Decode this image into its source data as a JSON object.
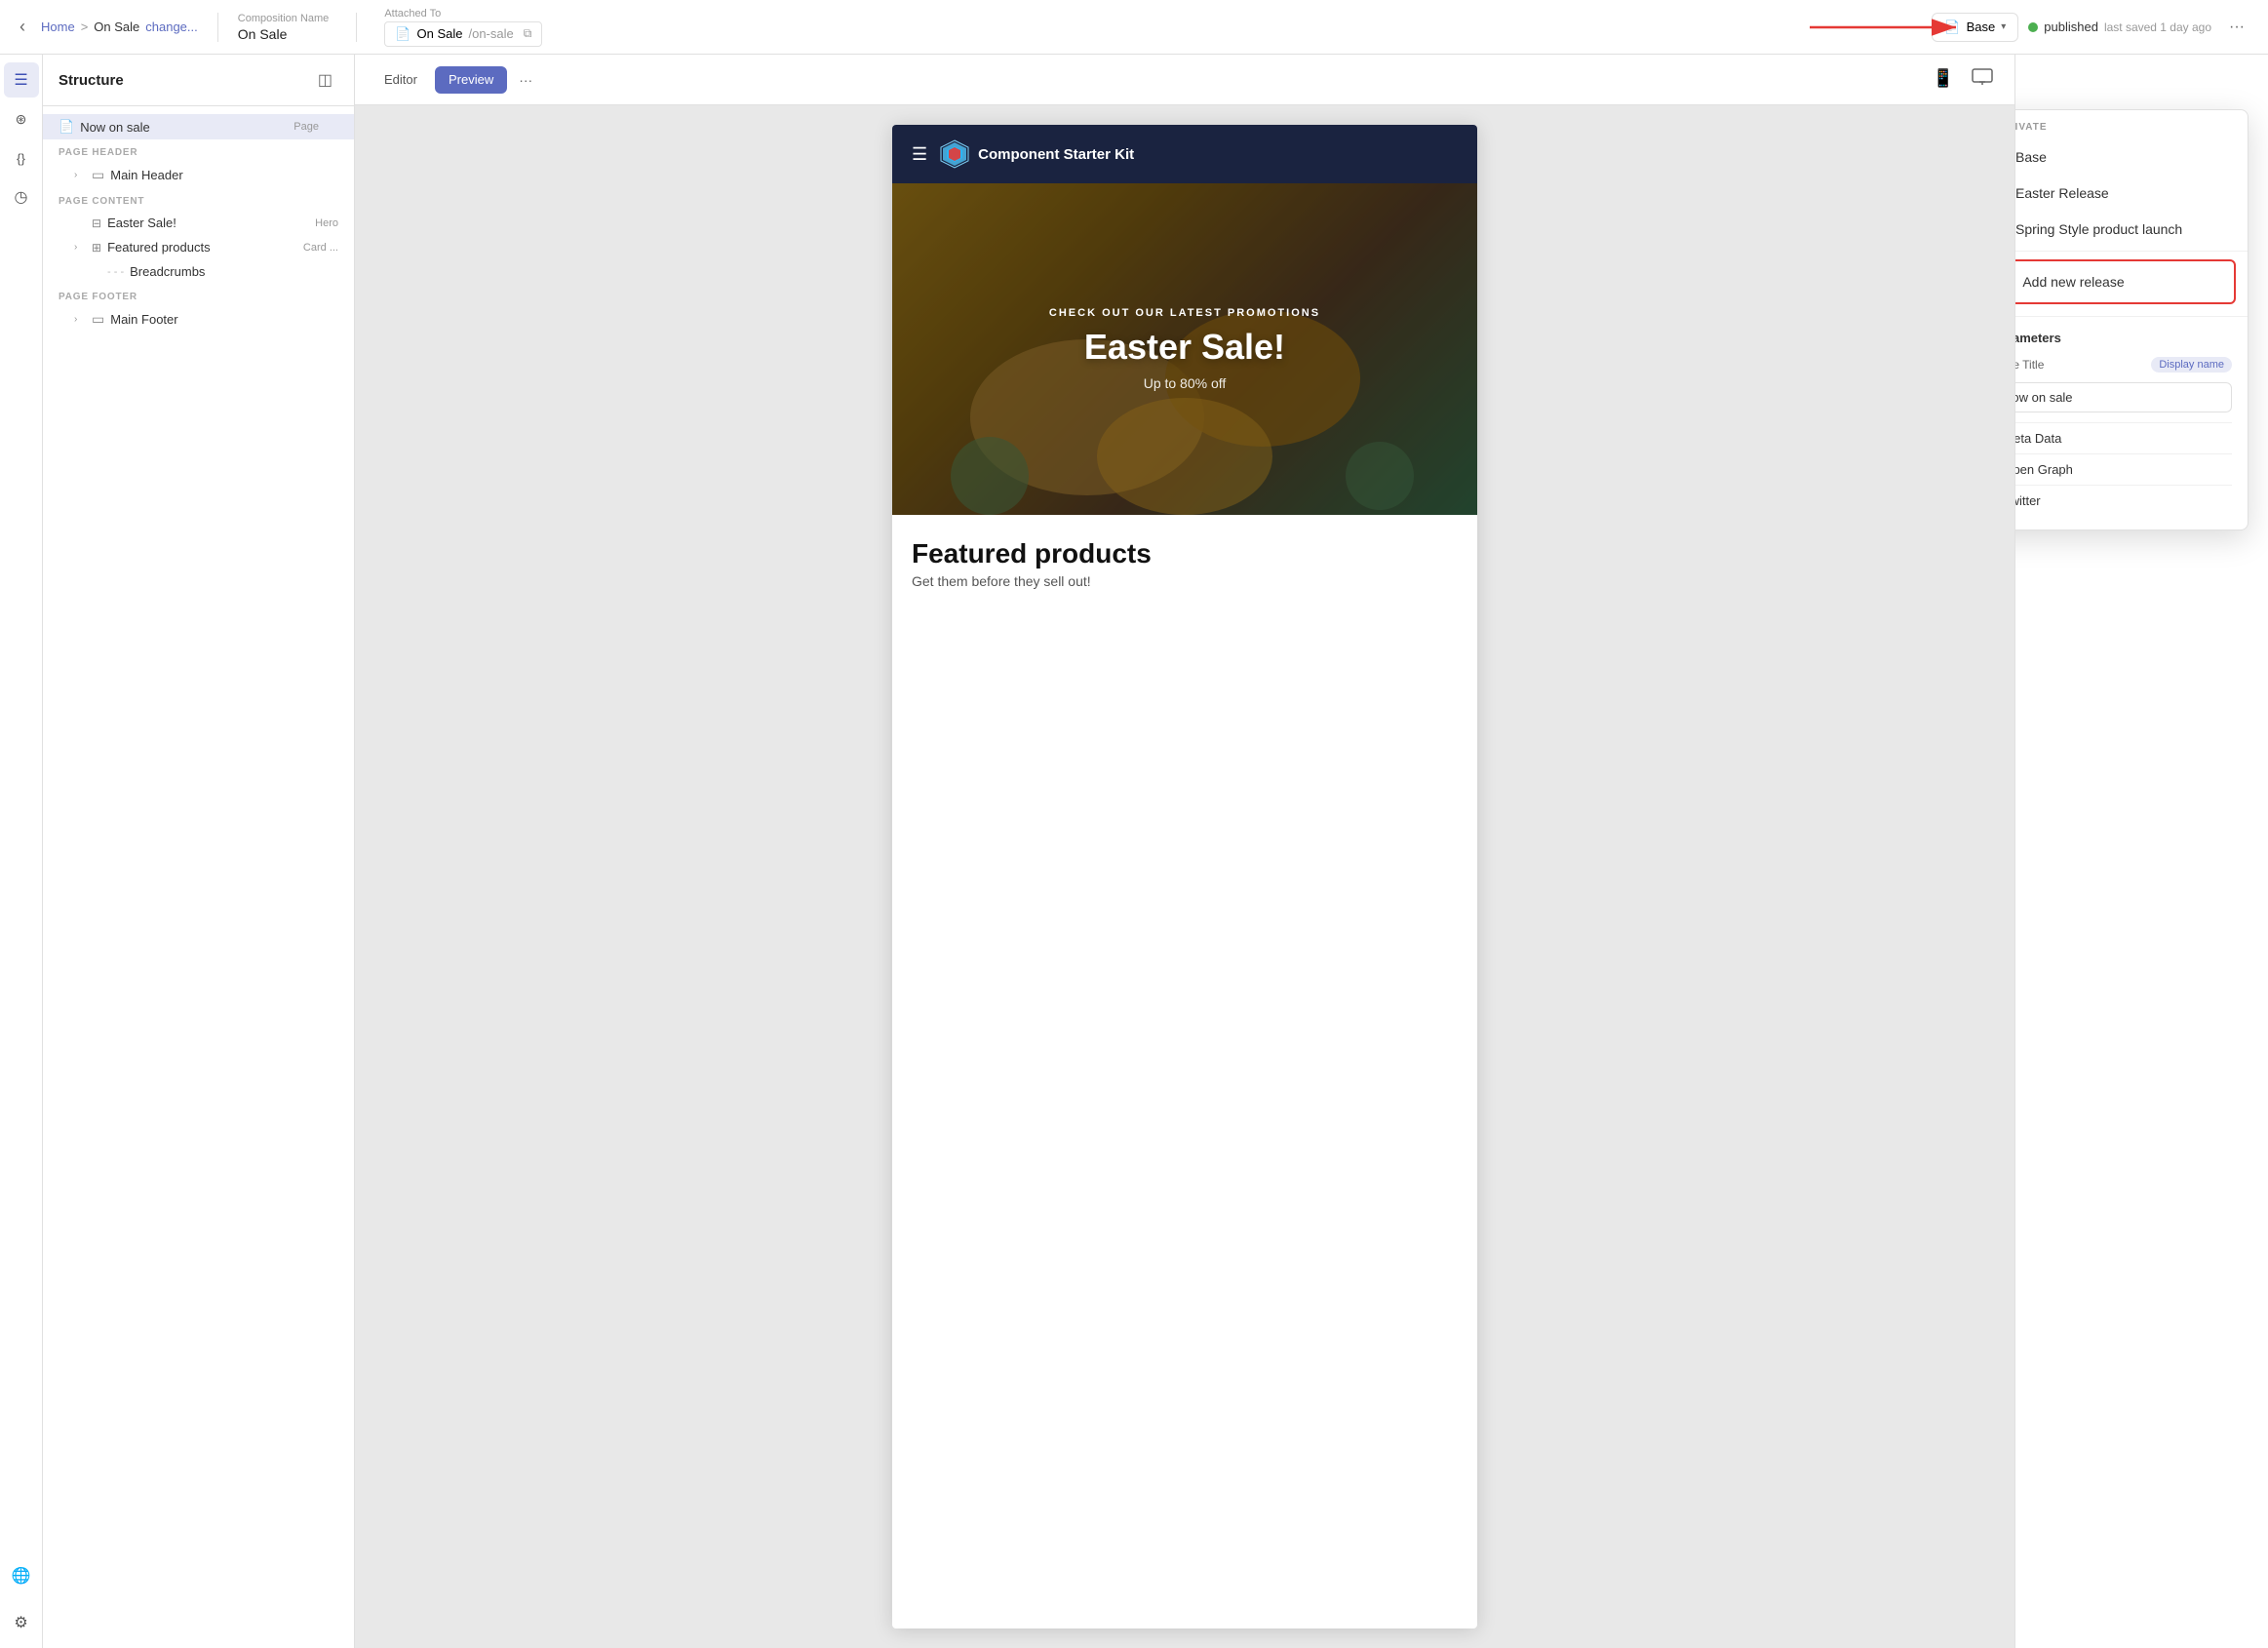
{
  "topbar": {
    "back_label": "‹",
    "breadcrumb": {
      "home": "Home",
      "sep": ">",
      "current": "On Sale",
      "change": "change..."
    },
    "comp_name_label": "Composition Name",
    "comp_name_value": "On Sale",
    "attached_label": "Attached To",
    "attached_page": "On Sale",
    "attached_path": "/on-sale",
    "base_btn": "Base",
    "published": "published",
    "saved": "last saved 1 day ago",
    "more": "···"
  },
  "icon_sidebar": {
    "icons": [
      {
        "name": "menu-icon",
        "symbol": "☰",
        "active": true
      },
      {
        "name": "layers-icon",
        "symbol": "⊕",
        "active": false
      },
      {
        "name": "code-icon",
        "symbol": "{}",
        "active": false
      },
      {
        "name": "history-icon",
        "symbol": "◷",
        "active": false
      },
      {
        "name": "globe-icon",
        "symbol": "⊕",
        "active": false
      },
      {
        "name": "settings-icon",
        "symbol": "⚙",
        "active": false,
        "bottom": true
      }
    ]
  },
  "structure": {
    "title": "Structure",
    "page_item": {
      "label": "Now on sale",
      "badge": "Page"
    },
    "sections": [
      {
        "label": "PAGE HEADER",
        "items": [
          {
            "indent": 1,
            "icon": "□",
            "label": "Main Header",
            "expandable": true
          }
        ]
      },
      {
        "label": "PAGE CONTENT",
        "items": [
          {
            "indent": 1,
            "icon": "⊟",
            "label": "Easter Sale!",
            "badge": "Hero"
          },
          {
            "indent": 1,
            "icon": "⊞",
            "label": "Featured products",
            "badge": "Card ...",
            "expandable": true
          },
          {
            "indent": 2,
            "icon": "---",
            "label": "Breadcrumbs",
            "dashed": true
          }
        ]
      },
      {
        "label": "PAGE FOOTER",
        "items": [
          {
            "indent": 1,
            "icon": "□",
            "label": "Main Footer",
            "expandable": true
          }
        ]
      }
    ]
  },
  "preview_toolbar": {
    "tabs": [
      "Editor",
      "Preview",
      "···"
    ],
    "active_tab": "Preview",
    "devices": [
      "📱",
      "🖥"
    ]
  },
  "preview_content": {
    "site_name": "Component Starter Kit",
    "hero": {
      "subtitle": "CHECK OUT OUR LATEST PROMOTIONS",
      "title": "Easter Sale!",
      "description": "Up to 80% off"
    },
    "featured": {
      "title": "Featured products",
      "subtitle": "Get them before they sell out!"
    }
  },
  "dropdown": {
    "activate_label": "ACTIVATE",
    "items": [
      {
        "label": "Base",
        "checked": true
      },
      {
        "label": "Easter Release",
        "checked": false
      },
      {
        "label": "Spring Style product launch",
        "checked": false
      }
    ],
    "add_new_release": "Add new release"
  },
  "right_panel": {
    "parameters_title": "Parameters",
    "page_title_label": "Page Title",
    "display_name_badge": "Display name",
    "page_title_value": "Now on sale",
    "collapsibles": [
      {
        "label": "Meta Data"
      },
      {
        "label": "Open Graph"
      },
      {
        "label": "Twitter"
      }
    ]
  }
}
